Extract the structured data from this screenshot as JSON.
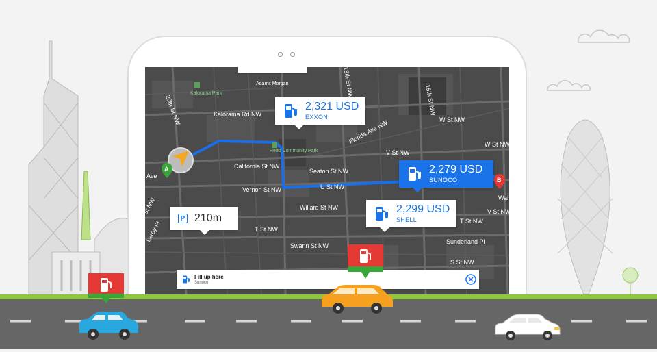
{
  "map": {
    "streets": {
      "adams_morgan": "Adams Morgan",
      "kalorama_park": "Kalorama Park",
      "kalorama_rd": "Kalorama Rd NW",
      "reed_park": "Reed Community Park",
      "california": "California St NW",
      "seaton": "Seaton St NW",
      "u_st": "U St NW",
      "vernon": "Vernon St NW",
      "willard": "Willard St NW",
      "t_st_left": "T St NW",
      "t_st_right": "T St NW",
      "swann": "Swann St NW",
      "s_st": "S St NW",
      "florida": "Florida Ave NW",
      "w_st": "W St NW",
      "w_st_right": "W St NW",
      "v_st": "V St NW",
      "v_st_right": "V St NW",
      "sunderland": "Sunderland Pl",
      "st_20th": "20th St NW",
      "st_18th": "18th St NW",
      "st_15th": "15th St NW",
      "ave_left": "Ave",
      "st_left": "St NW",
      "leroy": "Leroy Pl",
      "wal": "Wal"
    },
    "marker_a": "A",
    "marker_b": "B"
  },
  "stations": [
    {
      "price": "2,321 USD",
      "brand": "EXXON"
    },
    {
      "price": "2,279 USD",
      "brand": "SUNOCO"
    },
    {
      "price": "2,299 USD",
      "brand": "SHELL"
    }
  ],
  "parking": {
    "icon_letter": "P",
    "distance": "210m"
  },
  "fill_bar": {
    "title": "Fill up here",
    "subtitle": "Sunoco"
  },
  "colors": {
    "accent": "#1a73e8",
    "marker_a": "#3aa63a",
    "marker_b": "#e53935",
    "route": "#1a6fe8",
    "grass": "#8ec63f",
    "road": "#666666"
  }
}
